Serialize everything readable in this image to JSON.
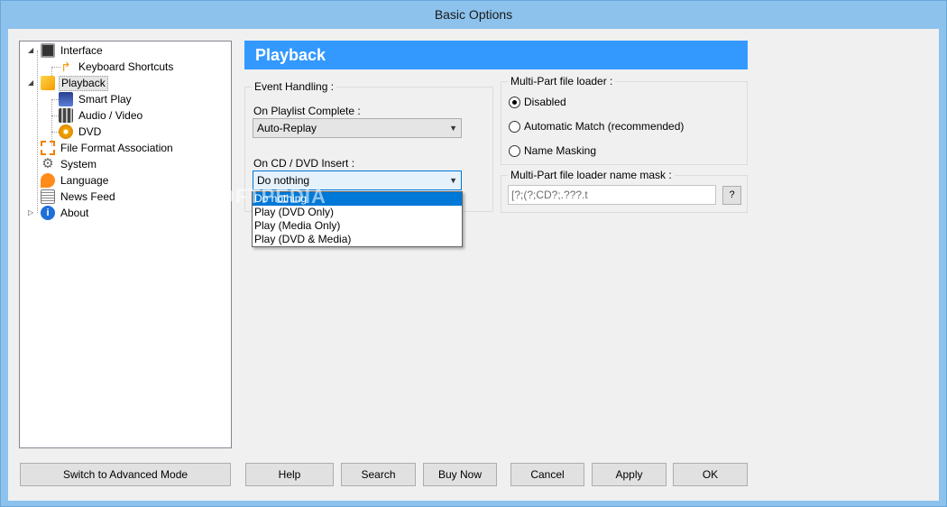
{
  "window": {
    "title": "Basic Options"
  },
  "tree": {
    "items": [
      {
        "label": "Interface",
        "icon": "monitor-icon",
        "color": "#333333"
      },
      {
        "label": "Keyboard Shortcuts",
        "icon": "cursor-icon",
        "color": "#f59b12"
      },
      {
        "label": "Playback",
        "icon": "pencil-icon",
        "color": "#f4b400"
      },
      {
        "label": "Smart Play",
        "icon": "graduation-cap-icon",
        "color": "#3a5fbf"
      },
      {
        "label": "Audio / Video",
        "icon": "film-icon",
        "color": "#555555"
      },
      {
        "label": "DVD",
        "icon": "dvd-icon",
        "color": "#f0a500"
      },
      {
        "label": "File Format Association",
        "icon": "network-icon",
        "color": "#f08000"
      },
      {
        "label": "System",
        "icon": "gear-icon",
        "color": "#7a7a7a"
      },
      {
        "label": "Language",
        "icon": "speech-bubble-icon",
        "color": "#ff8c1a"
      },
      {
        "label": "News Feed",
        "icon": "news-icon",
        "color": "#888888"
      },
      {
        "label": "About",
        "icon": "info-icon",
        "color": "#1e6fd9"
      }
    ]
  },
  "panel": {
    "title": "Playback"
  },
  "event_handling": {
    "title": "Event Handling :",
    "playlist_label": "On Playlist Complete :",
    "playlist_value": "Auto-Replay",
    "cd_label": "On CD / DVD Insert :",
    "cd_value": "Do nothing",
    "cd_options": [
      "Do nothing",
      "Play (DVD Only)",
      "Play (Media Only)",
      "Play (DVD & Media)"
    ]
  },
  "multipart": {
    "title": "Multi-Part file loader :",
    "options": [
      "Disabled",
      "Automatic Match (recommended)",
      "Name Masking"
    ],
    "mask_title": "Multi-Part file loader name mask :",
    "mask_value": "[?;(?;CD?;.???.t",
    "help_label": "?"
  },
  "buttons": {
    "advanced": "Switch to Advanced Mode",
    "help": "Help",
    "search": "Search",
    "buy": "Buy Now",
    "cancel": "Cancel",
    "apply": "Apply",
    "ok": "OK"
  },
  "watermark": "SOFTPEDIA"
}
